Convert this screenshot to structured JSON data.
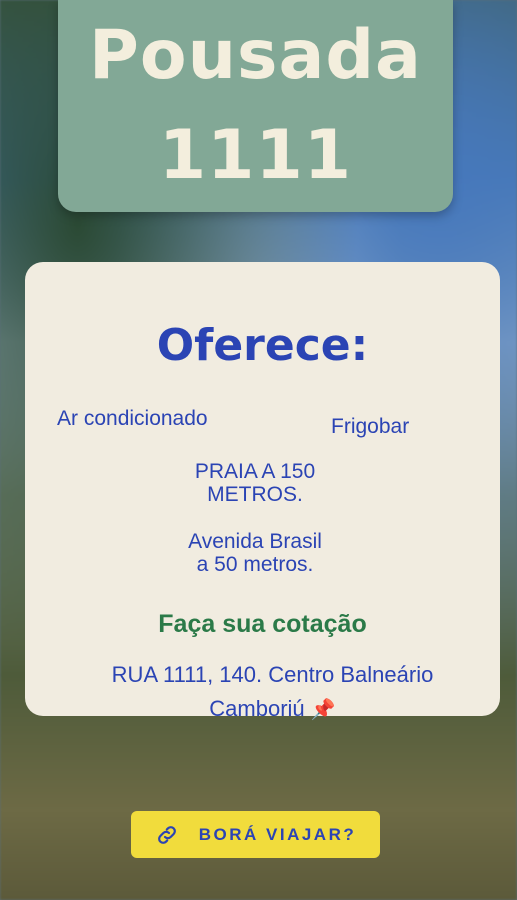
{
  "header": {
    "title_line1": "Pousada",
    "title_line2": "1111"
  },
  "card": {
    "title": "Oferece:",
    "features": {
      "ar": "Ar condicionado",
      "frigobar": "Frigobar",
      "praia": "PRAIA A 150 METROS.",
      "avenida": "Avenida Brasil a 50 metros."
    },
    "cta_text": "Faça sua cotação",
    "address": "RUA 1111, 140. Centro Balneário Camboriú",
    "address_icon": "📌"
  },
  "button": {
    "label": "BORÁ VIAJAR?",
    "icon": "link-icon"
  },
  "colors": {
    "title_box": "#82a896",
    "card_bg": "#f1ece0",
    "blue_text": "#2b44b4",
    "green_text": "#2b7a48",
    "button_bg": "#f1dc3c"
  }
}
